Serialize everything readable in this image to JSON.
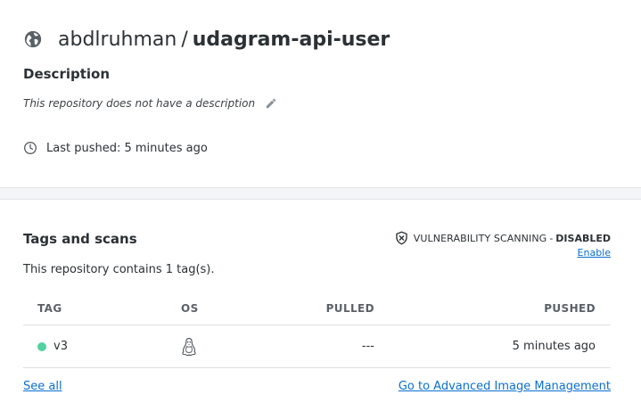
{
  "repo": {
    "owner": "abdlruhman",
    "separator": "/",
    "name": "udagram-api-user",
    "visibility_icon": "globe-icon"
  },
  "description": {
    "heading": "Description",
    "text": "This repository does not have a description",
    "edit_icon": "pencil-icon"
  },
  "last_pushed": {
    "icon": "clock-icon",
    "text": "Last pushed: 5 minutes ago"
  },
  "tags": {
    "heading": "Tags and scans",
    "vulnerability": {
      "icon": "shield-x-icon",
      "label": "VULNERABILITY SCANNING",
      "separator": "-",
      "status": "DISABLED",
      "enable_label": "Enable"
    },
    "count_text": "This repository contains 1 tag(s).",
    "columns": {
      "tag": "TAG",
      "os": "OS",
      "pulled": "PULLED",
      "pushed": "PUSHED"
    },
    "rows": [
      {
        "tag": "v3",
        "status_color": "#52d1a1",
        "os_icon": "linux-icon",
        "pulled": "---",
        "pushed": "5 minutes ago"
      }
    ],
    "see_all_label": "See all",
    "advanced_label": "Go to Advanced Image Management"
  },
  "colors": {
    "link": "#0b6fcf",
    "text": "#2b3135",
    "active_dot": "#52d1a1",
    "gutter": "#f4f5f7"
  }
}
